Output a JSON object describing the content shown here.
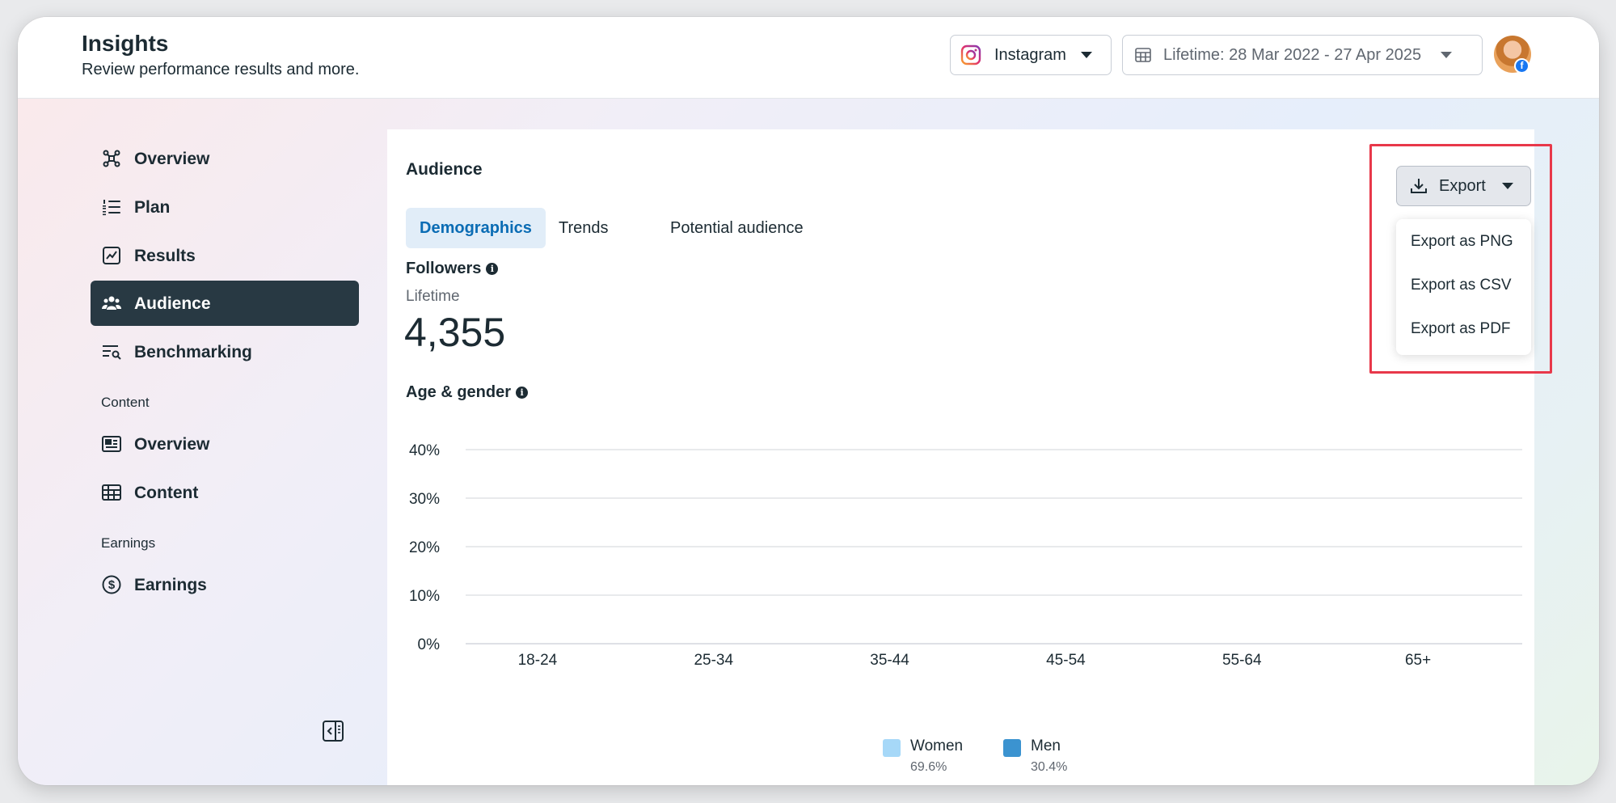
{
  "header": {
    "title": "Insights",
    "subtitle": "Review performance results and more.",
    "platform_label": "Instagram",
    "date_label": "Lifetime: 28 Mar 2022 - 27 Apr 2025",
    "avatar_badge": "f"
  },
  "sidebar": {
    "items": [
      {
        "label": "Overview",
        "icon": "network-icon"
      },
      {
        "label": "Plan",
        "icon": "numbered-list-icon"
      },
      {
        "label": "Results",
        "icon": "line-chart-icon"
      },
      {
        "label": "Audience",
        "icon": "people-icon",
        "active": true
      },
      {
        "label": "Benchmarking",
        "icon": "list-search-icon"
      }
    ],
    "content_section": "Content",
    "content_items": [
      {
        "label": "Overview",
        "icon": "newspaper-icon"
      },
      {
        "label": "Content",
        "icon": "table-icon"
      }
    ],
    "earnings_section": "Earnings",
    "earnings_items": [
      {
        "label": "Earnings",
        "icon": "dollar-circle-icon"
      }
    ]
  },
  "main": {
    "title": "Audience",
    "tabs": [
      {
        "label": "Demographics",
        "active": true
      },
      {
        "label": "Trends"
      },
      {
        "label": "Potential audience"
      }
    ],
    "followers": {
      "title": "Followers",
      "info": "i",
      "period": "Lifetime",
      "value": "4,355"
    },
    "age_gender_title": "Age & gender",
    "age_gender_info": "i"
  },
  "export": {
    "label": "Export",
    "menu": [
      "Export as PNG",
      "Export as CSV",
      "Export as PDF"
    ]
  },
  "colors": {
    "accent": "#0a6cb4",
    "sidebar_active": "#283943",
    "women": "#a6d8f8",
    "men": "#3b93d0",
    "highlight": "#e8384a"
  },
  "chart_data": {
    "type": "bar",
    "title": "Age & gender",
    "categories": [
      "18-24",
      "25-34",
      "35-44",
      "45-54",
      "55-64",
      "65+"
    ],
    "y_ticks": [
      "40%",
      "30%",
      "20%",
      "10%",
      "0%"
    ],
    "ylim": [
      0,
      40
    ],
    "grid": true,
    "series": [
      {
        "name": "Women",
        "share": "69.6%",
        "values": [
          0,
          0,
          0,
          0,
          0,
          0
        ]
      },
      {
        "name": "Men",
        "share": "30.4%",
        "values": [
          0,
          0,
          0,
          0,
          0,
          0
        ]
      }
    ],
    "legend_position": "bottom-center"
  }
}
